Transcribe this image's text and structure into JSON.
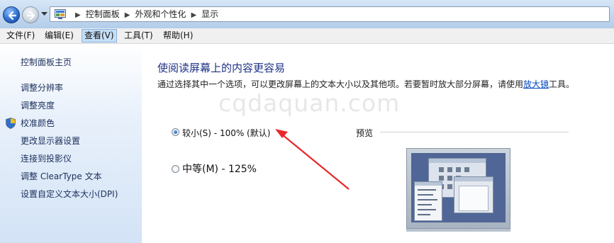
{
  "address_bar": {
    "breadcrumbs": [
      "控制面板",
      "外观和个性化",
      "显示"
    ]
  },
  "menubar": {
    "items": [
      "文件(F)",
      "编辑(E)",
      "查看(V)",
      "工具(T)",
      "帮助(H)"
    ],
    "active_index": 2
  },
  "sidebar": {
    "items": [
      "控制面板主页",
      "调整分辨率",
      "调整亮度",
      "校准颜色",
      "更改显示器设置",
      "连接到投影仪",
      "调整 ClearType 文本",
      "设置自定义文本大小(DPI)"
    ]
  },
  "main": {
    "heading": "使阅读屏幕上的内容更容易",
    "description_before_link": "通过选择其中一个选项，可以更改屏幕上的文本大小以及其他项。若要暂时放大部分屏幕，请使用",
    "magnifier_link": "放大镜",
    "description_after_link": "工具。",
    "options": [
      {
        "label": "较小(S) - 100% (默认)",
        "selected": true
      },
      {
        "label": "中等(M) - 125%",
        "selected": false
      }
    ],
    "preview_label": "预览"
  },
  "watermark": "cqdaquan.com",
  "colors": {
    "heading": "#1e3287",
    "link": "#0046c0",
    "annotation_arrow": "#e8282b",
    "sidebar_text": "#1b2f5b"
  }
}
